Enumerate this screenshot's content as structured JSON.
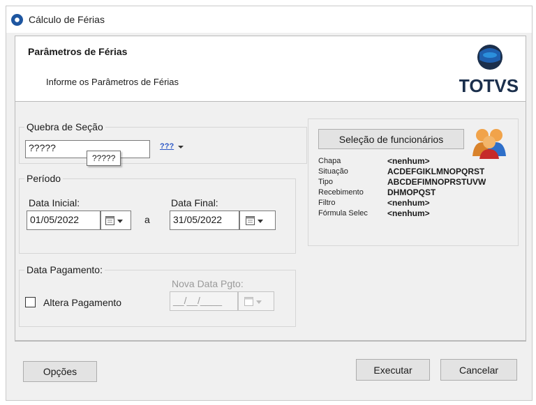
{
  "window": {
    "title": "Cálculo de Férias"
  },
  "header": {
    "title": "Parâmetros de Férias",
    "subtitle": "Informe os Parâmetros de Férias",
    "logo_text": "TOTVS",
    "logo_colors": {
      "dark": "#1b2f4c",
      "blue": "#1f5fae",
      "light": "#2b8fdc"
    }
  },
  "quebra_secao": {
    "label": "Quebra de Seção",
    "value": "?????",
    "tooltip": "?????",
    "lookup_icon_text": "???"
  },
  "periodo": {
    "label": "Período",
    "data_inicial_label": "Data Inicial:",
    "data_inicial_value": "01/05/2022",
    "separator": "a",
    "data_final_label": "Data Final:",
    "data_final_value": "31/05/2022"
  },
  "pagamento": {
    "label": "Data Pagamento:",
    "altera_label": "Altera Pagamento",
    "altera_checked": false,
    "nova_data_label": "Nova Data Pgto:",
    "nova_data_value": "__/__/____"
  },
  "selecao": {
    "button_label": "Seleção de funcionários",
    "rows": [
      {
        "label": "Chapa",
        "value": "<nenhum>"
      },
      {
        "label": "Situação",
        "value": "ACDEFGIKLMNOPQRST"
      },
      {
        "label": "Tipo",
        "value": "ABCDEFIMNOPRSTUVW"
      },
      {
        "label": "Recebimento",
        "value": "DHMOPQST"
      },
      {
        "label": "Filtro",
        "value": "<nenhum>"
      },
      {
        "label": "Fórmula Selec",
        "value": "<nenhum>"
      }
    ]
  },
  "footer": {
    "opcoes_label": "Opções",
    "executar_label": "Executar",
    "cancelar_label": "Cancelar"
  }
}
